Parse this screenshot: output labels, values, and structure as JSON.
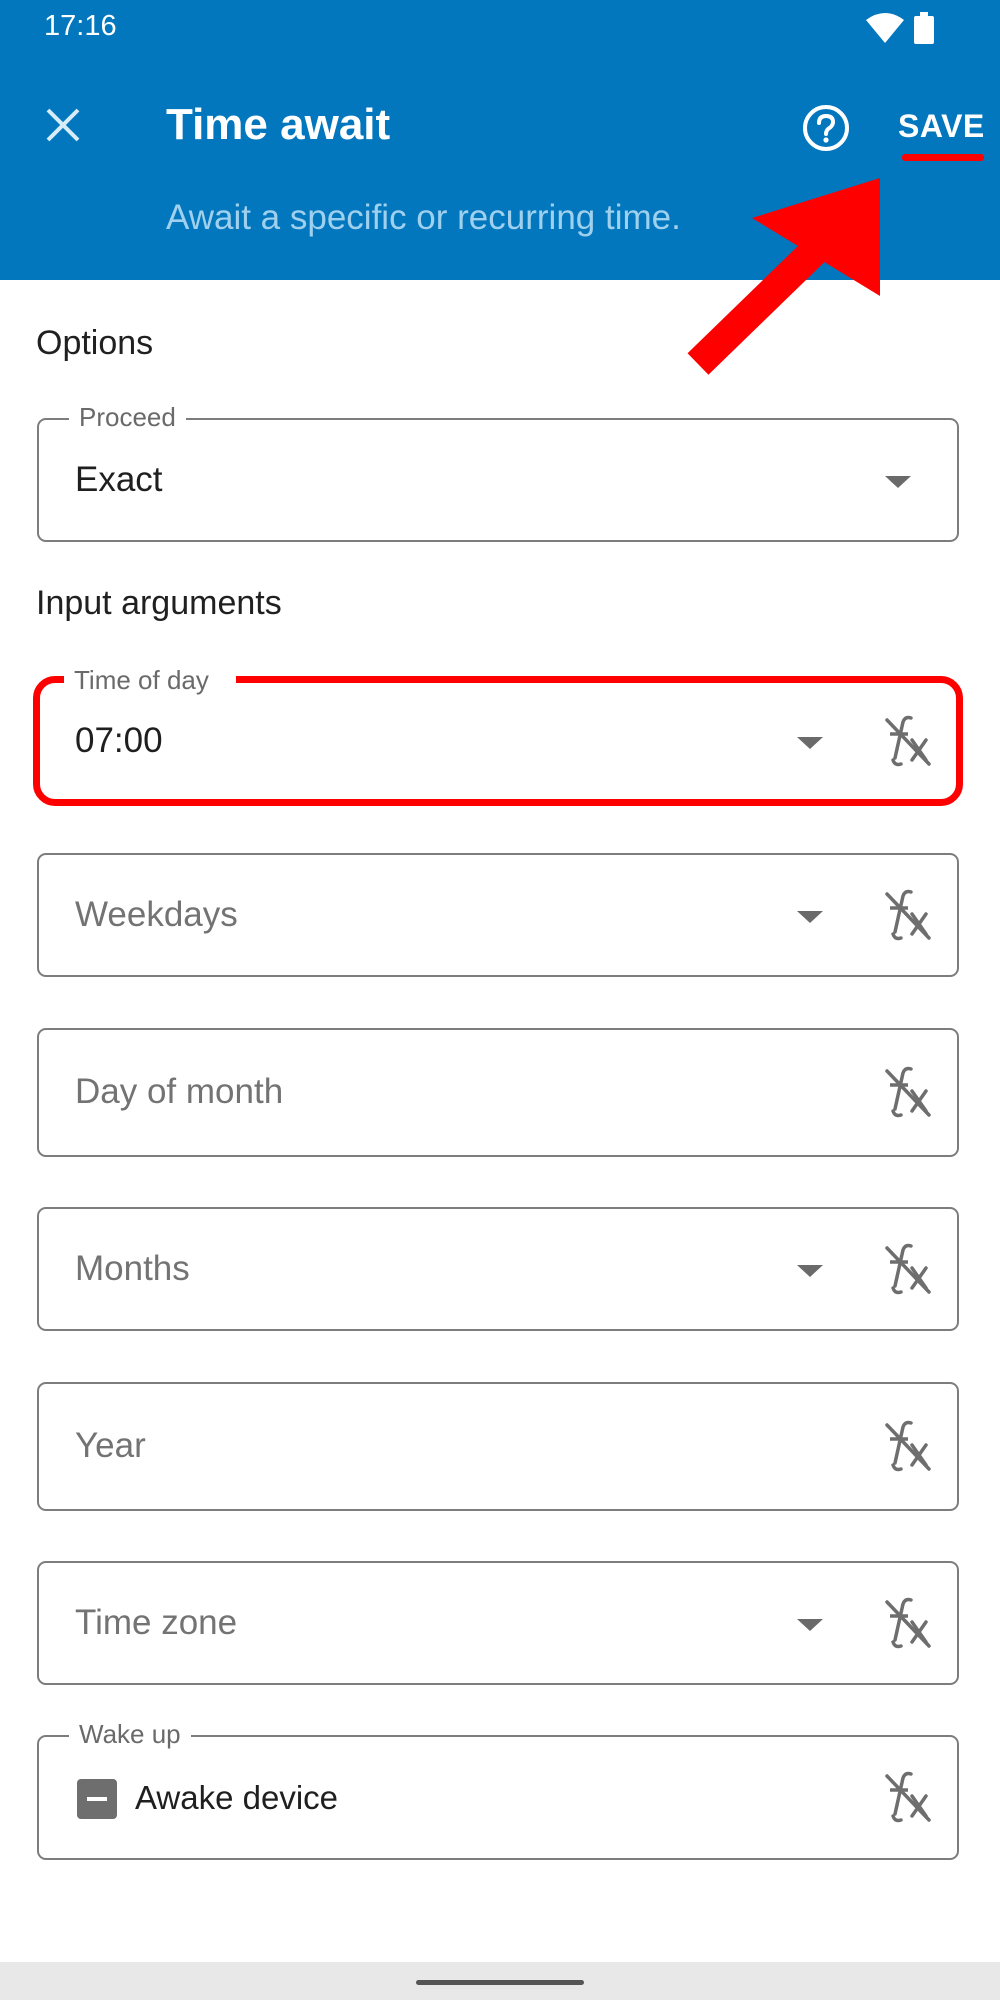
{
  "status_bar": {
    "time": "17:16"
  },
  "header": {
    "title": "Time await",
    "subtitle": "Await a specific or recurring time.",
    "save_label": "SAVE"
  },
  "colors": {
    "header": "#0277bd",
    "annotation": "#ff0000"
  },
  "sections": {
    "options": "Options",
    "input_arguments": "Input arguments"
  },
  "fields": {
    "proceed": {
      "label": "Proceed",
      "value": "Exact"
    },
    "time_of_day": {
      "label": "Time of day",
      "value": "07:00"
    },
    "weekdays": {
      "placeholder": "Weekdays"
    },
    "day_of_month": {
      "placeholder": "Day of month"
    },
    "months": {
      "placeholder": "Months"
    },
    "year": {
      "placeholder": "Year"
    },
    "time_zone": {
      "placeholder": "Time zone"
    },
    "wake_up": {
      "label": "Wake up",
      "checkbox_label": "Awake device",
      "checkbox_state": "indeterminate"
    }
  },
  "icons": [
    "close-icon",
    "help-icon",
    "dropdown-arrow-icon",
    "formula-off-icon",
    "wifi-icon",
    "battery-icon"
  ]
}
